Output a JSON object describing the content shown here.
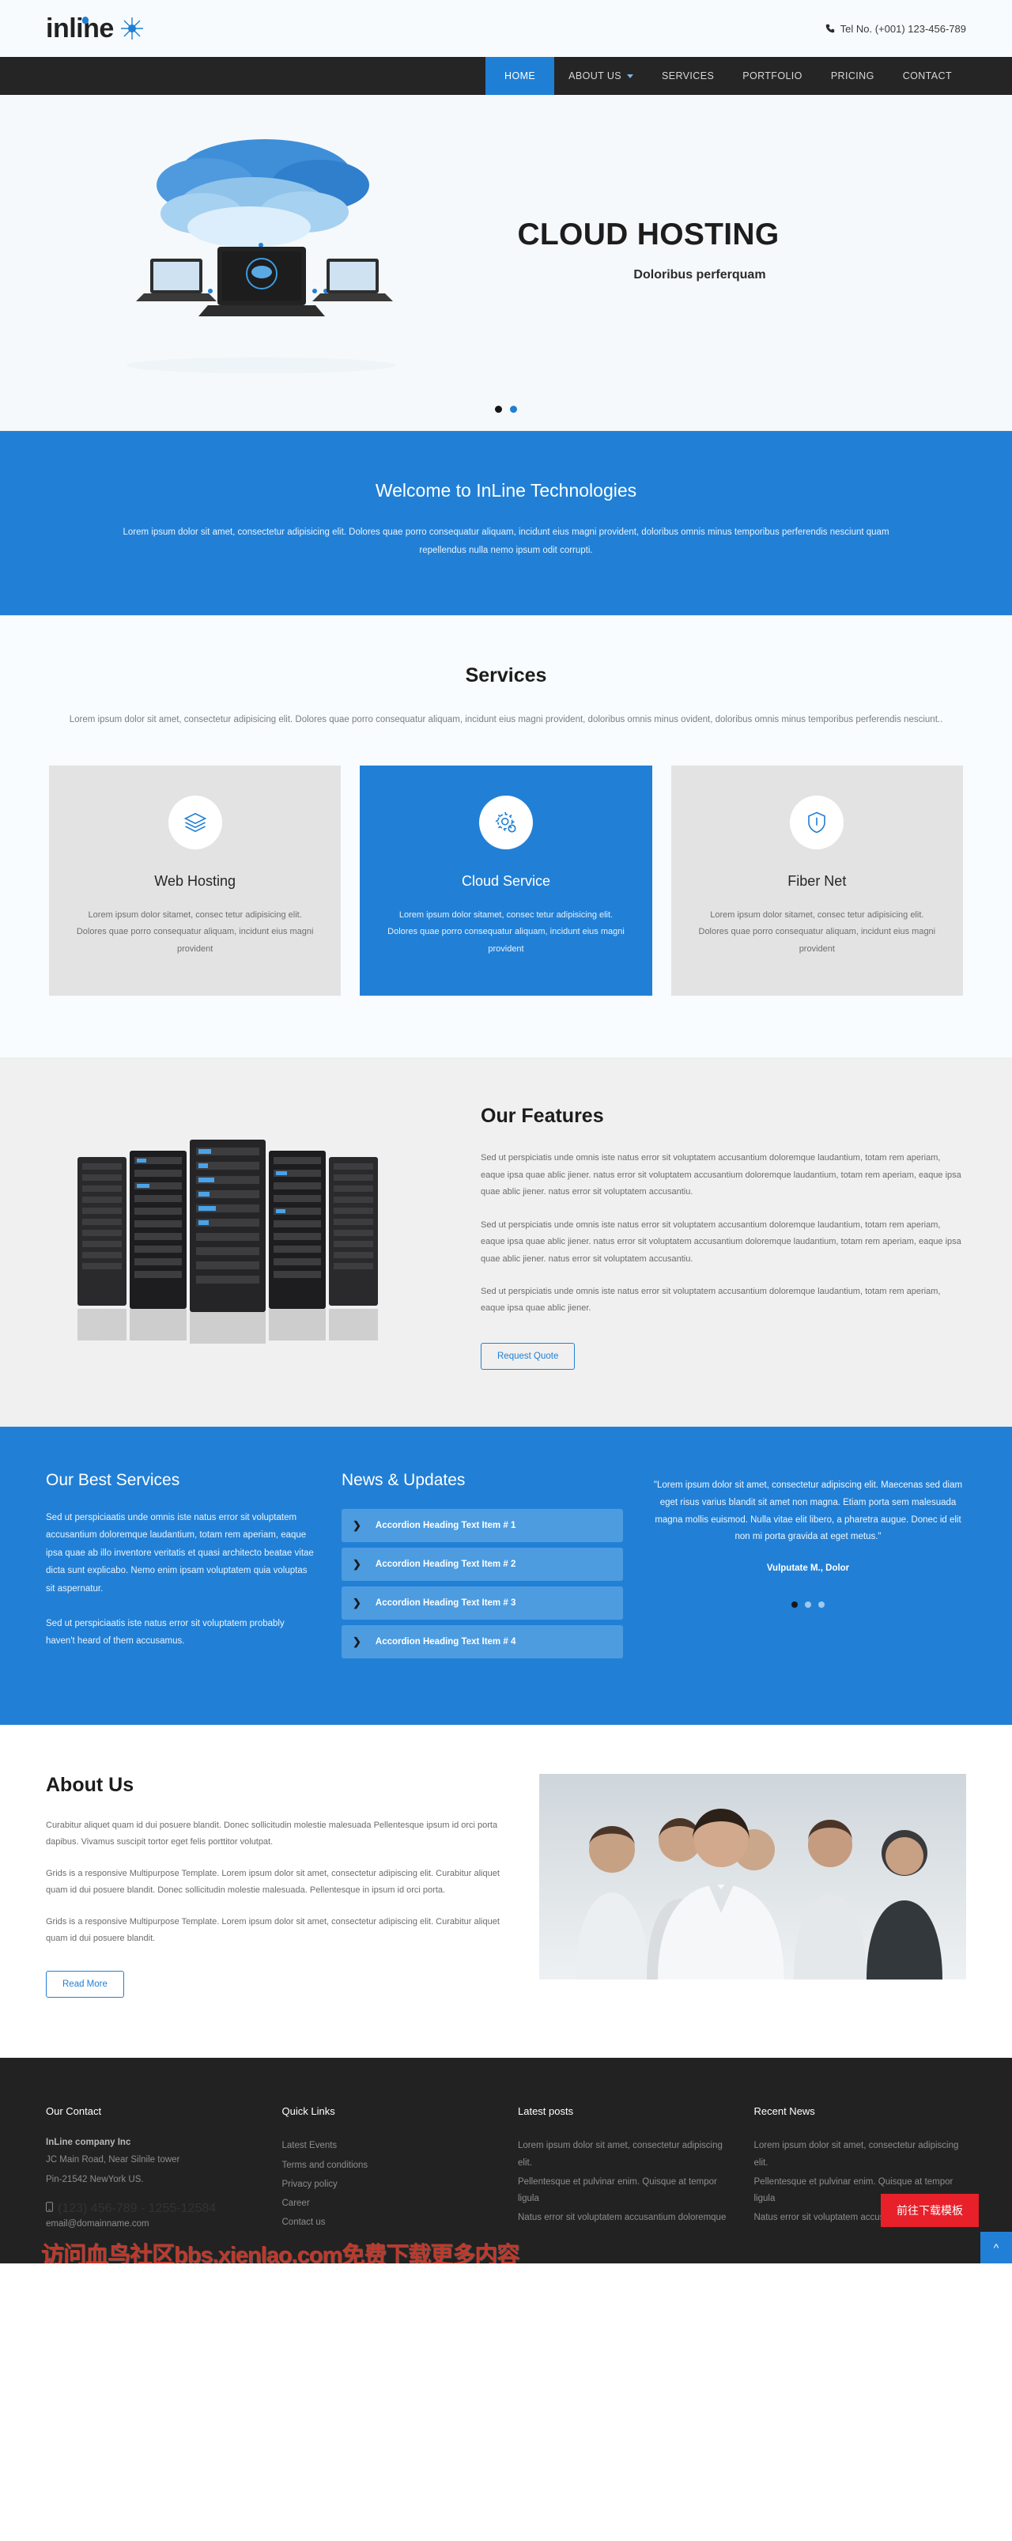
{
  "brand": {
    "name": "inline",
    "star_icon": "star-burst-icon",
    "accent": "#1e7fd4"
  },
  "topbar": {
    "phone_icon": "phone-icon",
    "tel": "Tel No. (+001) 123-456-789"
  },
  "nav": {
    "items": [
      {
        "label": "HOME",
        "active": true,
        "caret": false
      },
      {
        "label": "ABOUT US",
        "active": false,
        "caret": true
      },
      {
        "label": "SERVICES",
        "active": false,
        "caret": false
      },
      {
        "label": "PORTFOLIO",
        "active": false,
        "caret": false
      },
      {
        "label": "PRICING",
        "active": false,
        "caret": false
      },
      {
        "label": "CONTACT",
        "active": false,
        "caret": false
      }
    ]
  },
  "hero": {
    "title": "CLOUD HOSTING",
    "subtitle": "Doloribus perferquam",
    "image_alt": "cloud-hosting-illustration",
    "slides": [
      {
        "active": false
      },
      {
        "active": true
      }
    ]
  },
  "welcome": {
    "heading": "Welcome to InLine Technologies",
    "body": "Lorem ipsum dolor sit amet, consectetur adipisicing elit. Dolores quae porro consequatur aliquam, incidunt eius magni provident, doloribus omnis minus temporibus perferendis nesciunt quam repellendus nulla nemo ipsum odit corrupti."
  },
  "services": {
    "title": "Services",
    "lead": "Lorem ipsum dolor sit amet, consectetur adipisicing elit. Dolores quae porro consequatur aliquam, incidunt eius magni provident, doloribus omnis minus ovident, doloribus omnis minus temporibus perferendis nesciunt..",
    "cards": [
      {
        "icon": "layers-icon",
        "title": "Web Hosting",
        "text": "Lorem ipsum dolor sitamet, consec tetur adipisicing elit. Dolores quae porro consequatur aliquam, incidunt eius magni provident",
        "accent": false
      },
      {
        "icon": "gear-icon",
        "title": "Cloud Service",
        "text": "Lorem ipsum dolor sitamet, consec tetur adipisicing elit. Dolores quae porro consequatur aliquam, incidunt eius magni provident",
        "accent": true
      },
      {
        "icon": "shield-icon",
        "title": "Fiber Net",
        "text": "Lorem ipsum dolor sitamet, consec tetur adipisicing elit. Dolores quae porro consequatur aliquam, incidunt eius magni provident",
        "accent": false
      }
    ]
  },
  "features": {
    "title": "Our Features",
    "image_alt": "server-racks-photo",
    "paragraphs": [
      "Sed ut perspiciatis unde omnis iste natus error sit voluptatem accusantium doloremque laudantium, totam rem aperiam, eaque ipsa quae ablic jiener. natus error sit voluptatem accusantium doloremque laudantium, totam rem aperiam, eaque ipsa quae ablic jiener. natus error sit voluptatem accusantiu.",
      "Sed ut perspiciatis unde omnis iste natus error sit voluptatem accusantium doloremque laudantium, totam rem aperiam, eaque ipsa quae ablic jiener. natus error sit voluptatem accusantium doloremque laudantium, totam rem aperiam, eaque ipsa quae ablic jiener. natus error sit voluptatem accusantiu.",
      "Sed ut perspiciatis unde omnis iste natus error sit voluptatem accusantium doloremque laudantium, totam rem aperiam, eaque ipsa quae ablic jiener."
    ],
    "cta": "Request Quote"
  },
  "best": {
    "title": "Our Best Services",
    "paragraphs": [
      "Sed ut perspiciaatis unde omnis iste natus error sit voluptatem accusantium doloremque laudantium, totam rem aperiam, eaque ipsa quae ab illo inventore veritatis et quasi architecto beatae vitae dicta sunt explicabo. Nemo enim ipsam voluptatem quia voluptas sit aspernatur.",
      "Sed ut perspiciaatis iste natus error sit voluptatem probably haven't heard of them accusamus."
    ],
    "news_title": "News & Updates",
    "accordion": [
      {
        "chev": "chevron-right-icon",
        "label": "Accordion Heading Text Item # 1"
      },
      {
        "chev": "chevron-right-icon",
        "label": "Accordion Heading Text Item # 2"
      },
      {
        "chev": "chevron-right-icon",
        "label": "Accordion Heading Text Item # 3"
      },
      {
        "chev": "chevron-right-icon",
        "label": "Accordion Heading Text Item # 4"
      }
    ],
    "testimonial": {
      "quote": "\"Lorem ipsum dolor sit amet, consectetur adipiscing elit. Maecenas sed diam eget risus varius blandit sit amet non magna. Etiam porta sem malesuada magna mollis euismod. Nulla vitae elit libero, a pharetra augue. Donec id elit non mi porta gravida at eget metus.\"",
      "author": "Vulputate M., Dolor",
      "dots": [
        {
          "active": true
        },
        {
          "active": false
        },
        {
          "active": false
        }
      ]
    }
  },
  "about": {
    "title": "About Us",
    "paragraphs": [
      "Curabitur aliquet quam id dui posuere blandit. Donec sollicitudin molestie malesuada Pellentesque\nipsum id orci porta dapibus. Vivamus suscipit tortor eget felis porttitor volutpat.",
      "Grids is a responsive Multipurpose Template. Lorem ipsum dolor sit amet, consectetur adipiscing elit. Curabitur aliquet quam id dui posuere blandit. Donec sollicitudin molestie malesuada. Pellentesque in ipsum id orci porta.",
      "Grids is a responsive Multipurpose Template. Lorem ipsum dolor sit amet, consectetur adipiscing elit. Curabitur aliquet quam id dui posuere blandit."
    ],
    "cta": "Read More",
    "image_alt": "business-team-photo"
  },
  "footer": {
    "columns": [
      {
        "heading": "Our Contact",
        "company": "InLine company Inc",
        "lines": [
          "JC Main Road, Near Silnile tower",
          "Pin-21542 NewYork US."
        ],
        "phone_icon": "mobile-icon",
        "phone": "(123) 456-789 - 1255-12584",
        "email": "email@domainname.com"
      },
      {
        "heading": "Quick Links",
        "links": [
          "Latest Events",
          "Terms and conditions",
          "Privacy policy",
          "Career",
          "Contact us"
        ]
      },
      {
        "heading": "Latest posts",
        "posts": [
          "Lorem ipsum dolor sit amet, consectetur adipiscing elit.",
          "Pellentesque et pulvinar enim. Quisque at tempor ligula",
          "Natus error sit voluptatem accusantium doloremque"
        ]
      },
      {
        "heading": "Recent News",
        "posts": [
          "Lorem ipsum dolor sit amet, consectetur adipiscing elit.",
          "Pellentesque et pulvinar enim. Quisque at tempor ligula",
          "Natus error sit voluptatem accusantium doloremque"
        ]
      }
    ],
    "watermark": "访问血鸟社区bbs.xienlao.com免费下载更多内容",
    "download_button": "前往下载模板",
    "to_top_icon": "chevron-up-icon"
  }
}
